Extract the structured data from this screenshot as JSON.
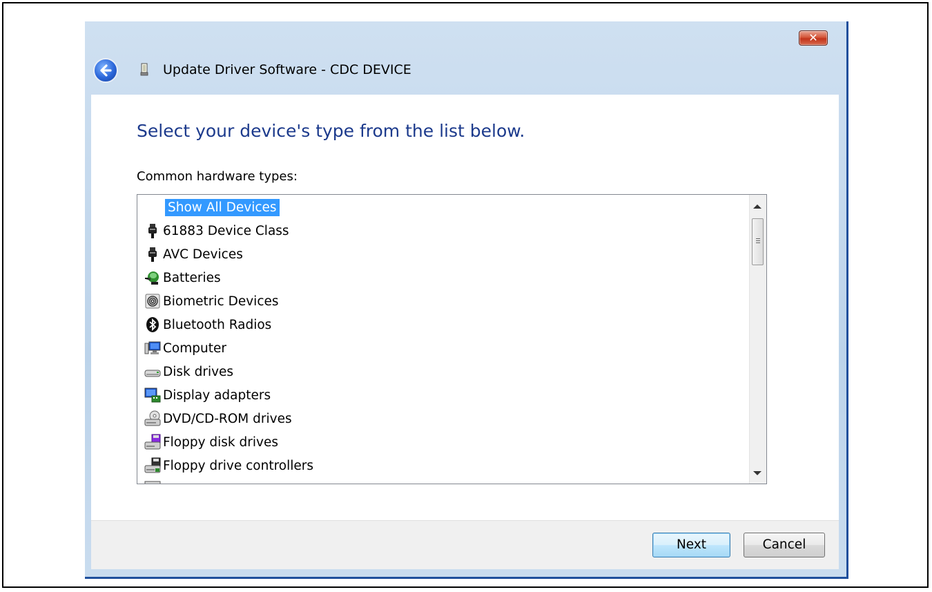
{
  "window": {
    "title": "Update Driver Software - CDC DEVICE",
    "close_symbol": "✕",
    "back_icon": "back-arrow-icon",
    "device_icon": "usb-device-icon"
  },
  "content": {
    "heading": "Select your device's type from the list below.",
    "list_label": "Common hardware types:",
    "items": [
      {
        "label": "Show All Devices",
        "icon": "none",
        "selected": true
      },
      {
        "label": "61883 Device Class",
        "icon": "firewire-plug-icon"
      },
      {
        "label": "AVC Devices",
        "icon": "firewire-plug-icon"
      },
      {
        "label": "Batteries",
        "icon": "battery-plug-icon"
      },
      {
        "label": "Biometric Devices",
        "icon": "fingerprint-icon"
      },
      {
        "label": "Bluetooth Radios",
        "icon": "bluetooth-icon"
      },
      {
        "label": "Computer",
        "icon": "computer-icon"
      },
      {
        "label": "Disk drives",
        "icon": "disk-drive-icon"
      },
      {
        "label": "Display adapters",
        "icon": "display-adapter-icon"
      },
      {
        "label": "DVD/CD-ROM drives",
        "icon": "dvd-drive-icon"
      },
      {
        "label": "Floppy disk drives",
        "icon": "floppy-drive-icon"
      },
      {
        "label": "Floppy drive controllers",
        "icon": "floppy-controller-icon"
      }
    ]
  },
  "buttons": {
    "next": "Next",
    "cancel": "Cancel"
  },
  "colors": {
    "heading": "#1c3a8c",
    "selection": "#3399ff",
    "frame": "#bcd3ea"
  }
}
